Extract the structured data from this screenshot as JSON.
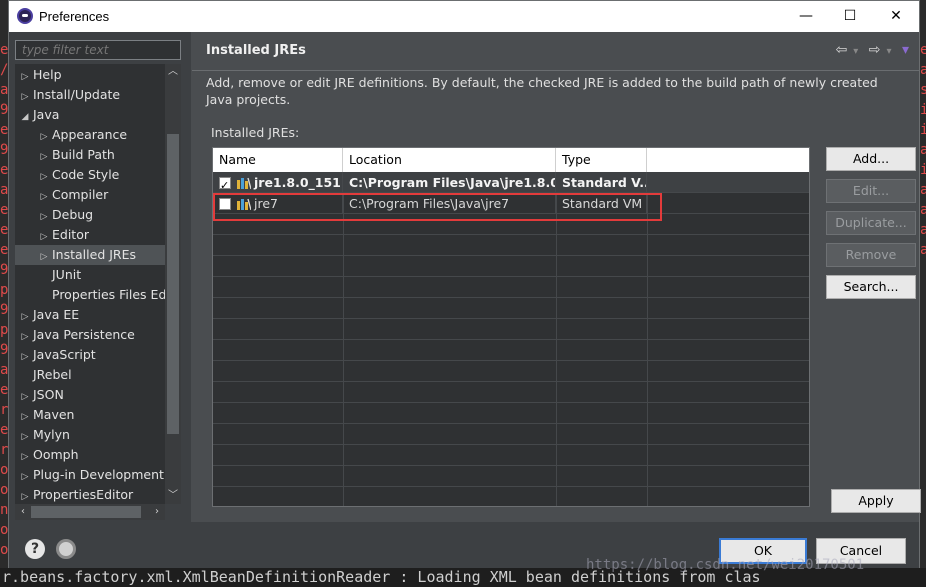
{
  "window": {
    "title": "Preferences",
    "minimize": "—",
    "maximize": "☐",
    "close": "✕"
  },
  "filter": {
    "placeholder": "type filter text"
  },
  "tree": {
    "items": [
      {
        "label": "Help",
        "twisty": "▷"
      },
      {
        "label": "Install/Update",
        "twisty": "▷"
      },
      {
        "label": "Java",
        "twisty": "◢"
      },
      {
        "label": "Appearance",
        "twisty": "▷"
      },
      {
        "label": "Build Path",
        "twisty": "▷"
      },
      {
        "label": "Code Style",
        "twisty": "▷"
      },
      {
        "label": "Compiler",
        "twisty": "▷"
      },
      {
        "label": "Debug",
        "twisty": "▷"
      },
      {
        "label": "Editor",
        "twisty": "▷"
      },
      {
        "label": "Installed JREs",
        "twisty": "▷"
      },
      {
        "label": "JUnit",
        "twisty": ""
      },
      {
        "label": "Properties Files Ed",
        "twisty": ""
      },
      {
        "label": "Java EE",
        "twisty": "▷"
      },
      {
        "label": "Java Persistence",
        "twisty": "▷"
      },
      {
        "label": "JavaScript",
        "twisty": "▷"
      },
      {
        "label": "JRebel",
        "twisty": ""
      },
      {
        "label": "JSON",
        "twisty": "▷"
      },
      {
        "label": "Maven",
        "twisty": "▷"
      },
      {
        "label": "Mylyn",
        "twisty": "▷"
      },
      {
        "label": "Oomph",
        "twisty": "▷"
      },
      {
        "label": "Plug-in Development",
        "twisty": "▷"
      },
      {
        "label": "PropertiesEditor",
        "twisty": "▷"
      }
    ],
    "selected": "Installed JREs"
  },
  "page": {
    "title": "Installed JREs",
    "description": "Add, remove or edit JRE definitions. By default, the checked JRE is added to the build path of newly created Java projects.",
    "table_label": "Installed JREs:"
  },
  "table": {
    "columns": [
      "Name",
      "Location",
      "Type"
    ],
    "rows": [
      {
        "checked": true,
        "name": "jre1.8.0_151 ...",
        "location": "C:\\Program Files\\Java\\jre1.8.0_...",
        "type": "Standard V..."
      },
      {
        "checked": false,
        "name": "jre7",
        "location": "C:\\Program Files\\Java\\jre7",
        "type": "Standard VM"
      }
    ]
  },
  "buttons": {
    "add": "Add...",
    "edit": "Edit...",
    "duplicate": "Duplicate...",
    "remove": "Remove",
    "search": "Search...",
    "apply": "Apply",
    "ok": "OK",
    "cancel": "Cancel"
  },
  "nav": {
    "back": "⇦",
    "forward": "⇨",
    "menu": "▾"
  },
  "watermark": "https://blog.csdn.net/wei20170501",
  "console_bottom": "r.beans.factory.xml.XmlBeanDefinitionReader : Loading XML bean definitions from clas",
  "colors": {
    "highlight": "#e33b3b",
    "ok_border": "#3a7bd5",
    "console_red": "#e04a4a"
  }
}
